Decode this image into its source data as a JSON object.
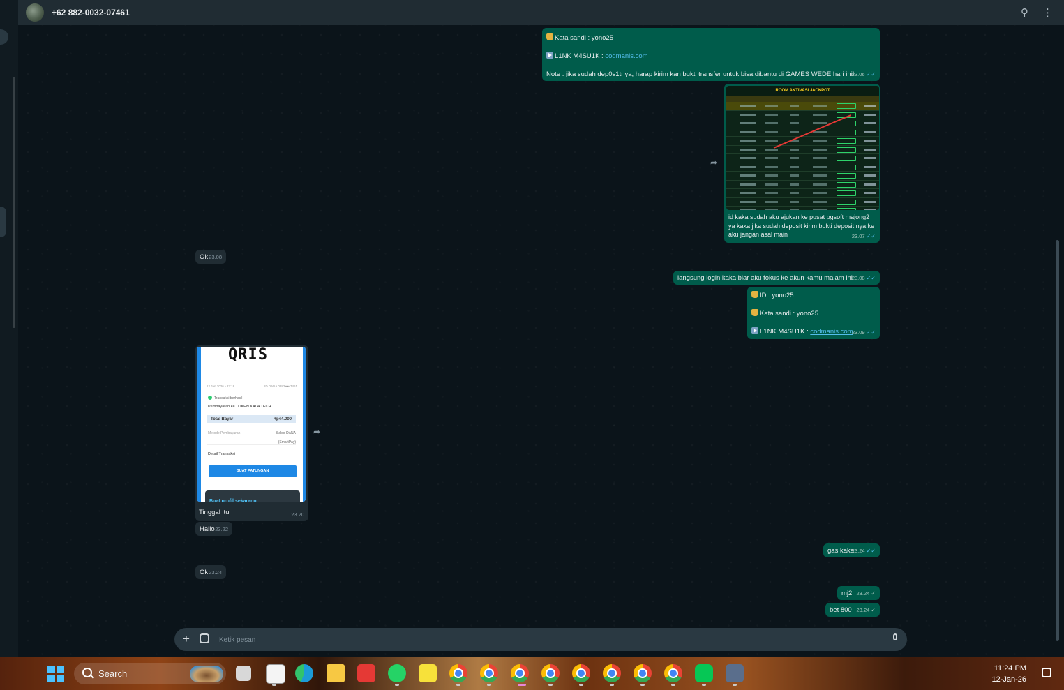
{
  "header": {
    "contact": "+62 882-0032-07461",
    "icons": [
      "search-icon",
      "more-options-icon"
    ]
  },
  "messages": [
    {
      "id": "m1",
      "dir": "out",
      "lines": [
        "Kata sandi : yono25",
        "L1NK M4SU1K : ",
        "Note : jika sudah dep0s1tnya, harap kirim kan bukti transfer untuk bisa dibantu di GAMES WEDE hari ini!"
      ],
      "link": "codmanis.com",
      "time": "23.06",
      "status": "read"
    },
    {
      "id": "m2",
      "dir": "out",
      "image": {
        "title": "ROOM AKTIVASI JACKPOT"
      },
      "caption": "id kaka sudah aku ajukan ke pusat pgsoft majong2 ya kaka jika sudah deposit kirim bukti deposit nya ke aku jangan asal main",
      "time": "23.07",
      "status": "read"
    },
    {
      "id": "m3",
      "dir": "in",
      "text": "Ok",
      "time": "23.08"
    },
    {
      "id": "m4",
      "dir": "out",
      "text": "langsung login kaka biar aku fokus ke akun kamu malam ini",
      "time": "23.08",
      "status": "read"
    },
    {
      "id": "m5",
      "dir": "out",
      "lines": [
        "ID :  yono25",
        "Kata sandi : yono25",
        "L1NK M4SU1K : "
      ],
      "link": "codmanis.com",
      "time": "23.09",
      "status": "read"
    },
    {
      "id": "m6",
      "dir": "in",
      "image": {
        "logo": "QRIS",
        "date": "12 Jan 2026 • 23:18",
        "account": "ID DANA 0882•••• 7461",
        "status": "Transaksi berhasil",
        "payment_to": "Pembayaran ke TOKEN KALA TECH..",
        "total_label": "Total Bayar",
        "total_value": "Rp44.000",
        "method_label": "Metode Pembayaran",
        "method_value": "Saldo DANA (SmartPay)",
        "detail_label": "Detail Transaksi",
        "cta": "BUAT PATUNGAN",
        "banner": "Buat profil sekarang"
      },
      "caption": "Tinggal itu",
      "time": "23.20"
    },
    {
      "id": "m7",
      "dir": "in",
      "text": "Hallo",
      "time": "23.22"
    },
    {
      "id": "m8",
      "dir": "out",
      "text": "gas kaka",
      "time": "23.24",
      "status": "read"
    },
    {
      "id": "m9",
      "dir": "in",
      "text": "Ok",
      "time": "23.24"
    },
    {
      "id": "m10",
      "dir": "out",
      "text": "mj2",
      "time": "23.24",
      "status": "sent"
    },
    {
      "id": "m11",
      "dir": "out",
      "text": "bet 800",
      "time": "23.24",
      "status": "sent"
    }
  ],
  "composer": {
    "placeholder": "Ketik pesan"
  },
  "taskbar": {
    "search_label": "Search",
    "time": "11:24 PM",
    "date": "12-Jan-26"
  },
  "ticks": {
    "read": "✓✓",
    "sent": "✓"
  },
  "colors": {
    "outgoing": "#005c4b",
    "incoming": "#202c33",
    "background": "#0b141a",
    "link": "#53bdeb"
  }
}
